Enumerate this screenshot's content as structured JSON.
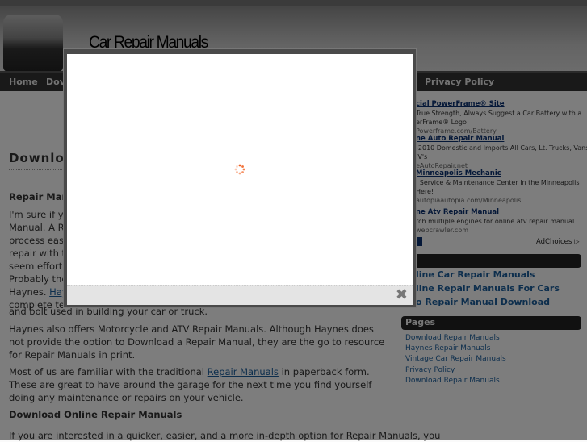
{
  "header": {
    "site_title": "Car Repair Manuals"
  },
  "nav": {
    "items": [
      {
        "label": "Home"
      },
      {
        "label": "Dov"
      },
      {
        "label": "Privacy Policy"
      }
    ]
  },
  "main": {
    "heading": "Downloa",
    "subheading": "Repair Man",
    "p1_lines": [
      "I'm sure if yo",
      "Manual. A Re",
      "process easy",
      "repair with th",
      "seem effortle"
    ],
    "p2_lines": [
      "Probably the",
      "Haynes.",
      "Hayn",
      "complete tea",
      "and bolt used in building your car or truck."
    ],
    "p3": "Haynes also offers Motorcycle and ATV Repair Manuals. Although Haynes does not provide the option to Download a Repair Manual, they are the go to resource for Repair Manuals in print.",
    "p4_before": "Most of us are familiar with the traditional ",
    "p4_link": "Repair Manuals",
    "p4_after": " in paperback form. These are great to have around the garage for the next time you find yourself doing any maintenance or repairs on your vehicle.",
    "h3b": "Download Online Repair Manuals",
    "p5": "If you are interested in a quicker, easier, and a more in-depth option for Repair Manuals, you"
  },
  "sidebar": {
    "ads": [
      {
        "title": "cial PowerFrame® Site",
        "lines": [
          "True Strength, Always Suggest a Car Battery with a",
          "erFrame® Logo"
        ],
        "url": "Powerframe.com/Battery"
      },
      {
        "title": "ne Auto Repair Manual",
        "lines": [
          "-2010 Domestic and Imports All Cars, Lt. Trucks, Vans",
          "JV's"
        ],
        "url": "eAutoRepair.net"
      },
      {
        "title": "Minneapolis Mechanic",
        "lines": [
          "l Service & Maintenance Center In the Minneapolis",
          "Here!"
        ],
        "url": "autopiaautopia.com/Minneapolis"
      },
      {
        "title": "ne Atv Repair Manual",
        "lines": [
          "rch multiple engines for online atv repair manual"
        ],
        "url": "webcrawler.com"
      }
    ],
    "adchoices": "AdChoices",
    "blogroll": [
      "line Car Repair Manuals",
      "line Repair Manuals For Cars",
      "o Repair Manual Download"
    ],
    "pages_title": "Pages",
    "pages": [
      "Download Repair Manuals",
      "Haynes Repair Manuals",
      "Vintage Car Repair Manuals",
      "Privacy Policy",
      "Download Repair Manuals"
    ]
  },
  "modal": {
    "state": "loading",
    "close_icon": "close-x",
    "spinner_color": "#f06020"
  }
}
